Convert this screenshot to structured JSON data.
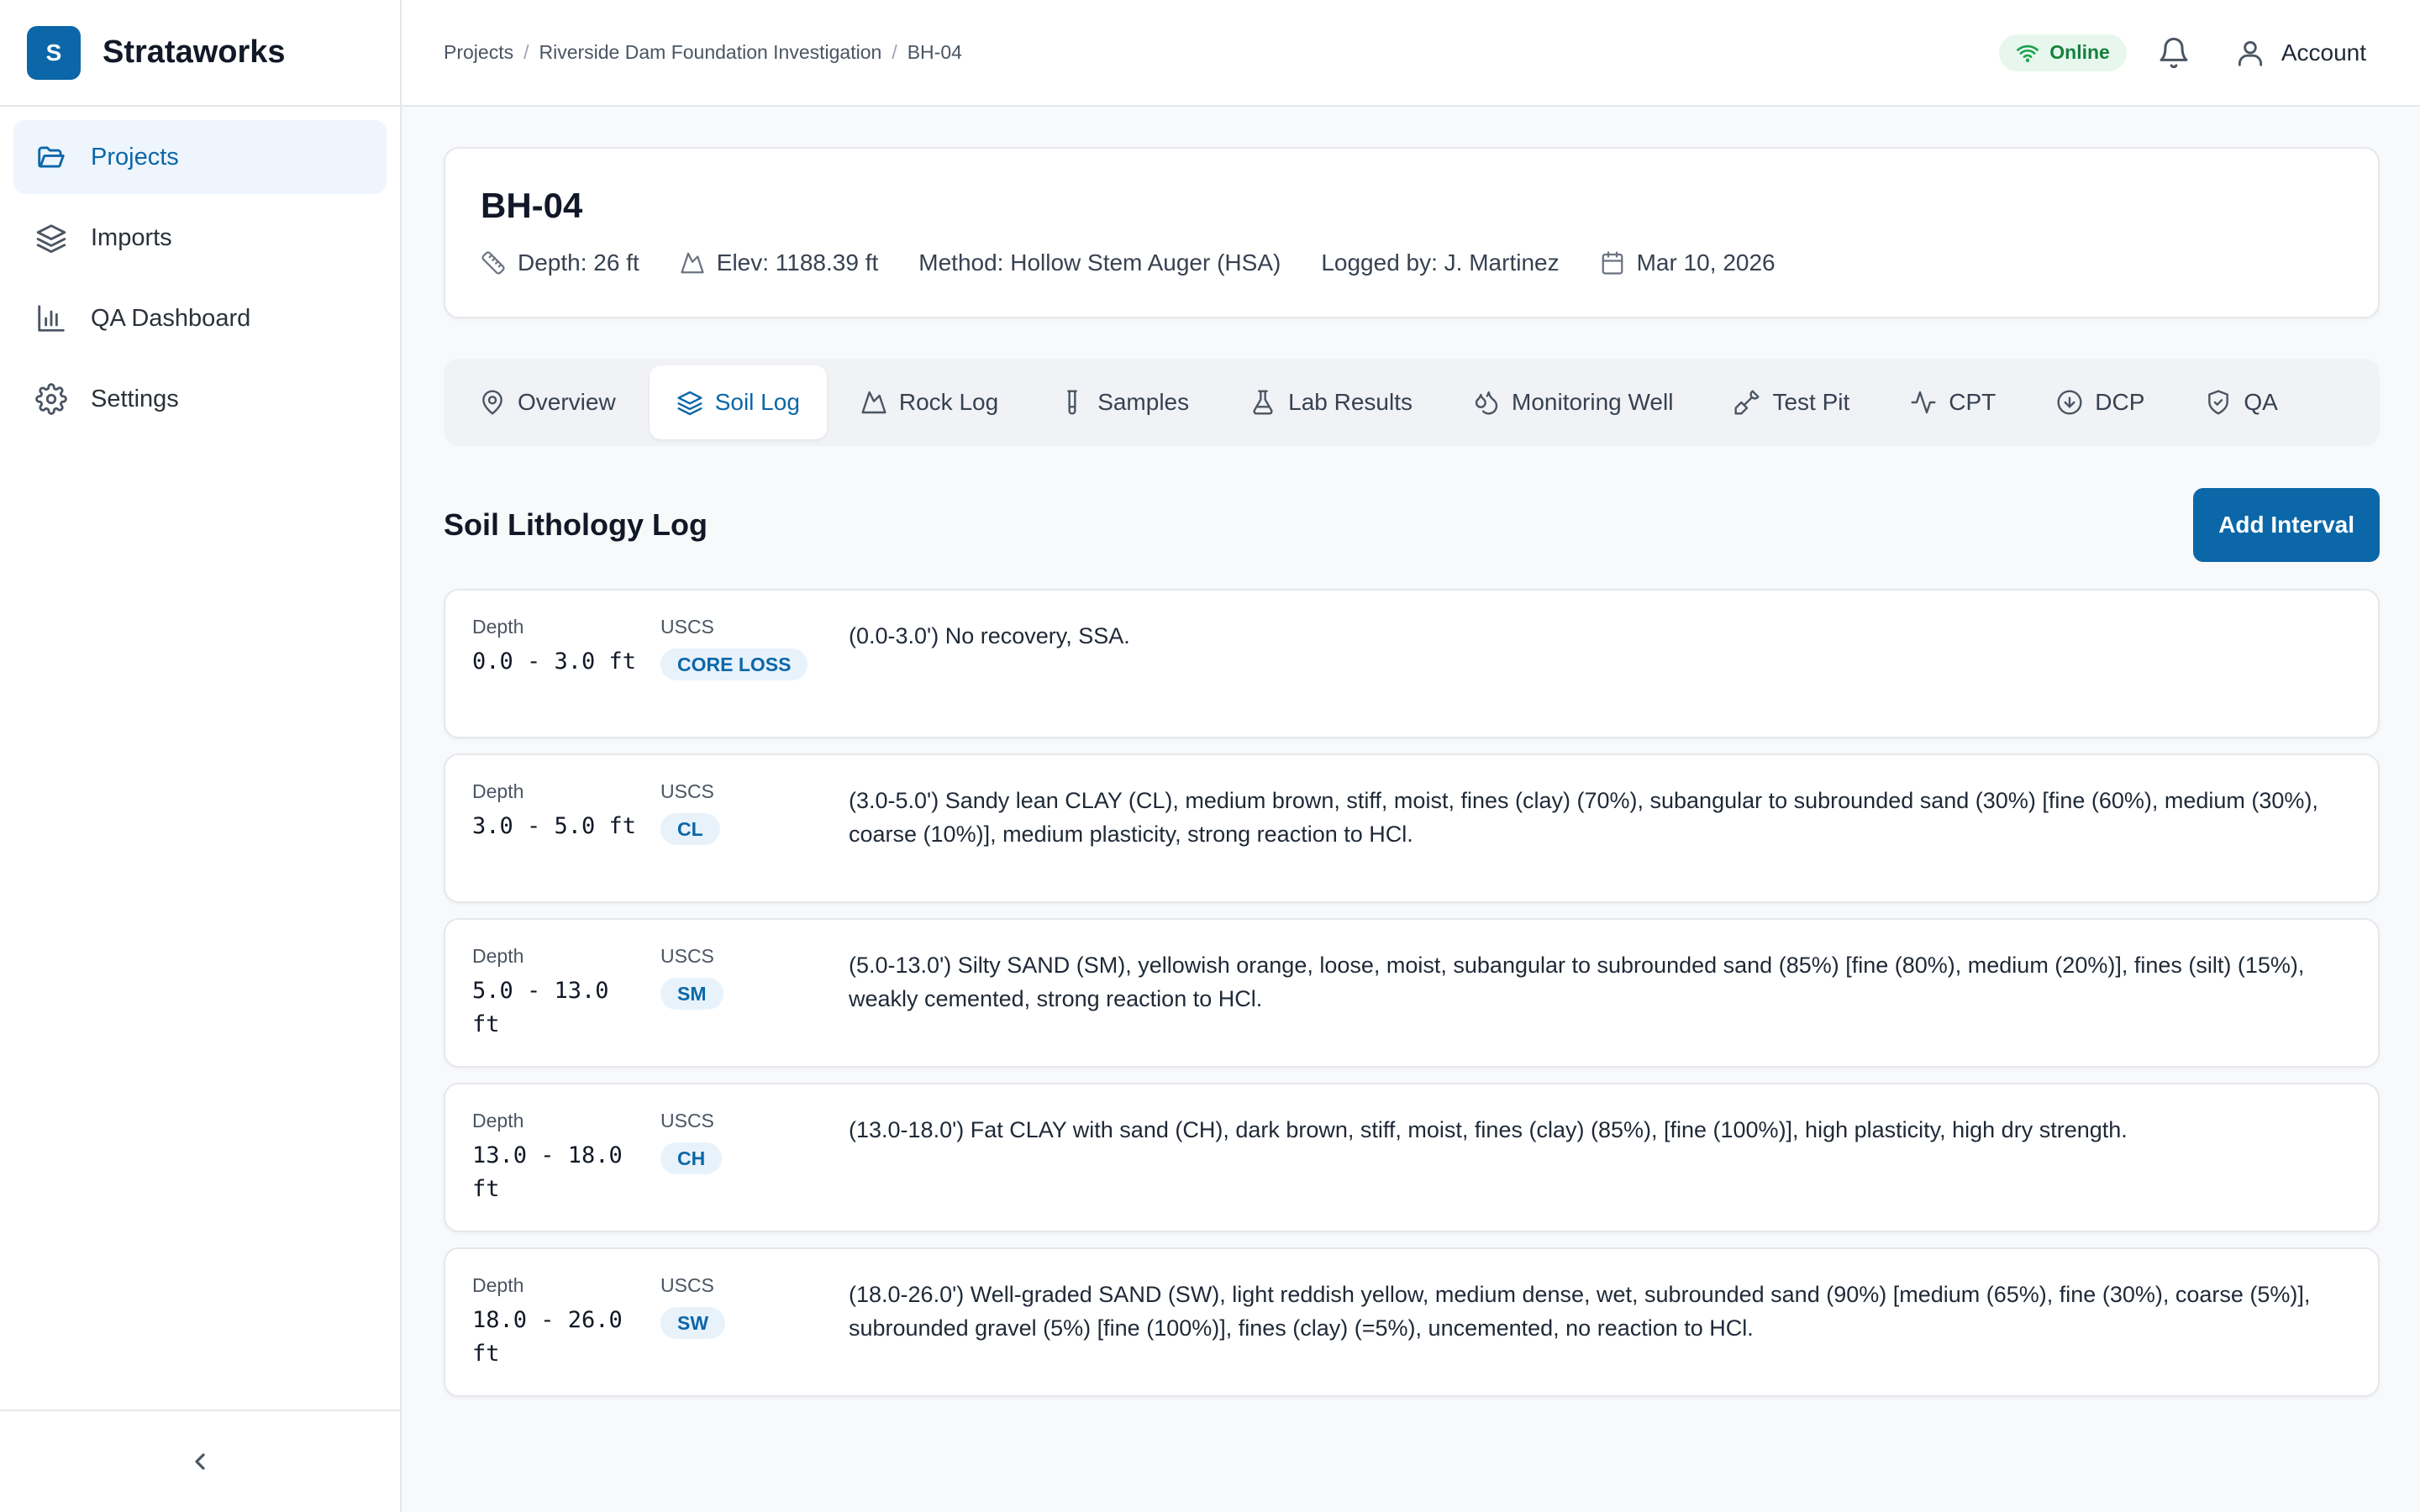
{
  "brand": {
    "logo_letter": "S",
    "name": "Strataworks"
  },
  "sidebar": {
    "items": [
      {
        "label": "Projects",
        "icon": "folder-open-icon",
        "active": true
      },
      {
        "label": "Imports",
        "icon": "layers-icon"
      },
      {
        "label": "QA Dashboard",
        "icon": "bar-chart-icon"
      },
      {
        "label": "Settings",
        "icon": "gear-icon"
      }
    ],
    "collapse_icon": "chevron-left-icon"
  },
  "breadcrumb": [
    "Projects",
    "Riverside Dam Foundation Investigation",
    "BH-04"
  ],
  "topbar": {
    "status": "Online",
    "account_label": "Account"
  },
  "borehole": {
    "title": "BH-04",
    "depth": "Depth: 26 ft",
    "elevation": "Elev: 1188.39 ft",
    "method": "Method: Hollow Stem Auger (HSA)",
    "logged_by": "Logged by: J. Martinez",
    "date": "Mar 10, 2026"
  },
  "tabs": [
    {
      "label": "Overview",
      "icon": "map-pin-icon"
    },
    {
      "label": "Soil Log",
      "icon": "layers-icon",
      "active": true
    },
    {
      "label": "Rock Log",
      "icon": "mountain-icon"
    },
    {
      "label": "Samples",
      "icon": "test-tube-icon"
    },
    {
      "label": "Lab Results",
      "icon": "flask-icon"
    },
    {
      "label": "Monitoring Well",
      "icon": "droplets-icon"
    },
    {
      "label": "Test Pit",
      "icon": "shovel-icon"
    },
    {
      "label": "CPT",
      "icon": "activity-icon"
    },
    {
      "label": "DCP",
      "icon": "arrow-down-circle-icon"
    },
    {
      "label": "QA",
      "icon": "shield-check-icon"
    }
  ],
  "soil_log": {
    "title": "Soil Lithology Log",
    "add_button": "Add Interval",
    "depth_label": "Depth",
    "uscs_label": "USCS",
    "intervals": [
      {
        "depth": "0.0 - 3.0 ft",
        "uscs": "CORE LOSS",
        "description": "(0.0-3.0') No recovery, SSA."
      },
      {
        "depth": "3.0 - 5.0 ft",
        "uscs": "CL",
        "description": "(3.0-5.0') Sandy lean CLAY (CL), medium brown, stiff, moist, fines (clay) (70%), subangular to subrounded sand (30%) [fine (60%), medium (30%), coarse (10%)], medium plasticity, strong reaction to HCl."
      },
      {
        "depth": "5.0 - 13.0 ft",
        "uscs": "SM",
        "description": "(5.0-13.0') Silty SAND (SM), yellowish orange, loose, moist, subangular to subrounded sand (85%) [fine (80%), medium (20%)], fines (silt) (15%), weakly cemented, strong reaction to HCl."
      },
      {
        "depth": "13.0 - 18.0 ft",
        "uscs": "CH",
        "description": "(13.0-18.0') Fat CLAY with sand (CH), dark brown, stiff, moist, fines (clay) (85%), [fine (100%)], high plasticity, high dry strength."
      },
      {
        "depth": "18.0 - 26.0 ft",
        "uscs": "SW",
        "description": "(18.0-26.0') Well-graded SAND (SW), light reddish yellow, medium dense, wet, subrounded sand (90%) [medium (65%), fine (30%), coarse (5%)], subrounded gravel (5%) [fine (100%)], fines (clay) (=5%), uncemented, no reaction to HCl."
      }
    ]
  },
  "colors": {
    "accent": "#0b67a8",
    "online": "#15803d",
    "badge_bg": "#e8f2fb"
  }
}
